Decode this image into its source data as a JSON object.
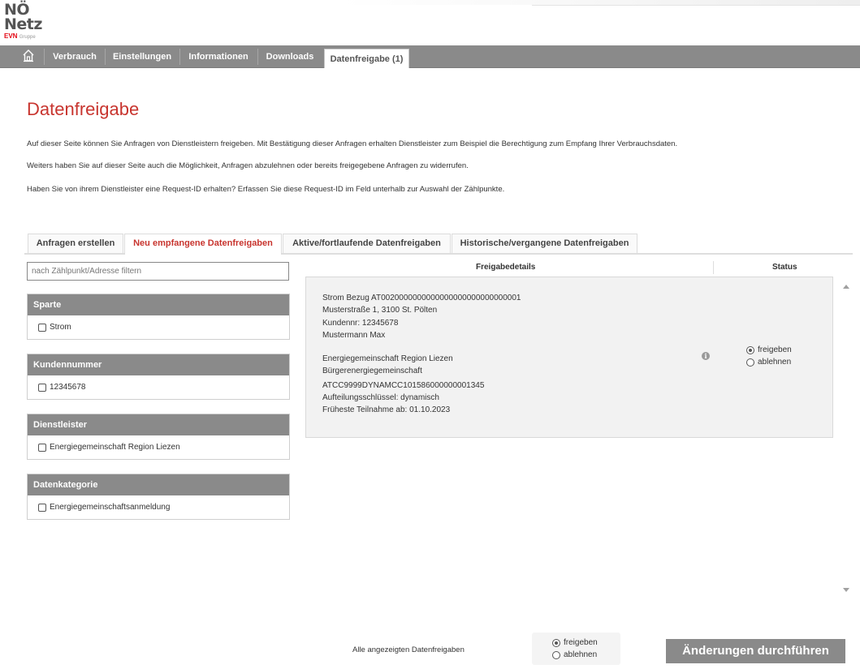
{
  "logo": {
    "line1": "NÖ",
    "line2": "Netz",
    "brand": "EVN",
    "group": "Gruppe"
  },
  "nav": {
    "home_icon": "home-icon",
    "items": [
      {
        "label": "Verbrauch"
      },
      {
        "label": "Einstellungen"
      },
      {
        "label": "Informationen"
      },
      {
        "label": "Downloads"
      },
      {
        "label": "Datenfreigabe (1)",
        "active": true
      }
    ]
  },
  "page": {
    "title": "Datenfreigabe",
    "intro": [
      "Auf dieser Seite können Sie Anfragen von Dienstleistern freigeben. Mit Bestätigung dieser Anfragen erhalten Dienstleister zum Beispiel die Berechtigung zum Empfang Ihrer Verbrauchsdaten.",
      "Weiters haben Sie auf dieser Seite auch die Möglichkeit, Anfragen abzulehnen oder bereits freigegebene Anfragen zu widerrufen.",
      "Haben Sie von ihrem Dienstleister eine Request-ID erhalten? Erfassen Sie diese Request-ID im Feld unterhalb zur Auswahl der Zählpunkte."
    ]
  },
  "tabs": [
    {
      "label": "Anfragen erstellen"
    },
    {
      "label": "Neu empfangene Datenfreigaben",
      "active": true
    },
    {
      "label": "Aktive/fortlaufende Datenfreigaben"
    },
    {
      "label": "Historische/vergangene Datenfreigaben"
    }
  ],
  "filter": {
    "placeholder": "nach Zählpunkt/Adresse filtern",
    "groups": [
      {
        "title": "Sparte",
        "option": "Strom",
        "checked": false
      },
      {
        "title": "Kundennummer",
        "option": "12345678",
        "checked": false
      },
      {
        "title": "Dienstleister",
        "option": "Energiegemeinschaft Region Liezen",
        "checked": false
      },
      {
        "title": "Datenkategorie",
        "option": "Energiegemeinschaftsanmeldung",
        "checked": false
      }
    ]
  },
  "details": {
    "col_details": "Freigabedetails",
    "col_status": "Status",
    "card": {
      "line1": "Strom Bezug AT0020000000000000000000000000001",
      "line2": "Musterstraße 1, 3100 St. Pölten",
      "line3": "Kundennr: 12345678",
      "line4": "Mustermann Max",
      "line5": "Energiegemeinschaft Region Liezen",
      "line6": "Bürgerenergiegemeinschaft",
      "line7": "ATCC9999DYNAMCC101586000000001345",
      "line8": "Aufteilungsschlüssel: dynamisch",
      "line9": "Früheste Teilnahme ab: 01.10.2023",
      "info_icon": "info-icon",
      "status_options": [
        "freigeben",
        "ablehnen"
      ],
      "status_selected": "freigeben"
    }
  },
  "footer": {
    "bulk_label": "Alle angezeigten Datenfreigaben",
    "bulk_options": [
      "freigeben",
      "ablehnen"
    ],
    "bulk_selected": "freigeben",
    "submit_label": "Änderungen durchführen"
  },
  "colors": {
    "accent": "#c8352f",
    "nav_bg": "#8a8a8a",
    "card_bg": "#f2f2f2",
    "logo_red": "#e30613"
  }
}
